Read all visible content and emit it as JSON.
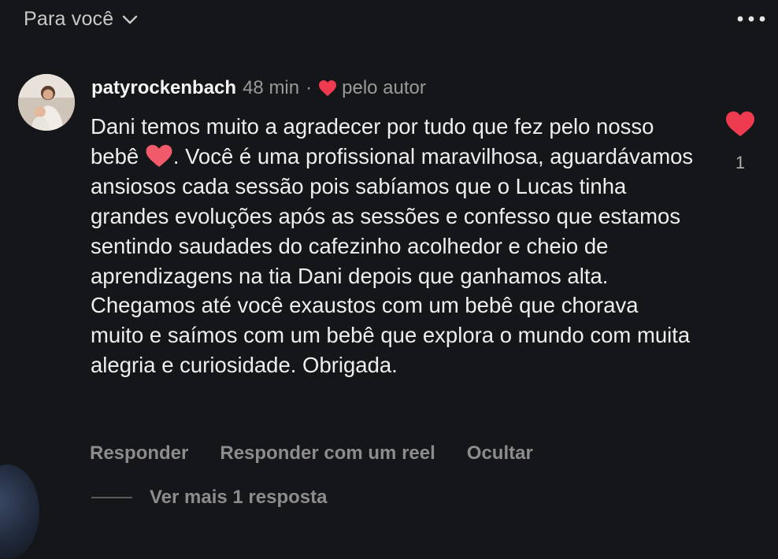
{
  "header": {
    "sort_label": "Para você",
    "sort_icon": "chevron-down-icon",
    "more_icon": "more-horizontal-icon"
  },
  "comment": {
    "username": "patyrockenbach",
    "time": "48 min",
    "separator": "·",
    "liked_by_author": "pelo autor",
    "text_part1": "Dani temos muito a agradecer por tudo que fez pelo nosso bebê",
    "text_part2": ". Você é uma profissional maravilhosa, aguardávamos ansiosos cada sessão pois sabíamos que o Lucas tinha grandes evoluções após as sessões e confesso que estamos sentindo saudades do cafezinho acolhedor e cheio de aprendizagens na tia Dani depois que ganhamos alta. Chegamos até você exaustos com um bebê que chorava muito e saímos com um bebê que explora o mundo com muita alegria e curiosidade. Obrigada.",
    "like_count": "1",
    "heart_color": "#ee3b4f"
  },
  "actions": {
    "reply": "Responder",
    "reply_reel": "Responder com um reel",
    "hide": "Ocultar"
  },
  "replies": {
    "label": "Ver mais 1 resposta"
  }
}
